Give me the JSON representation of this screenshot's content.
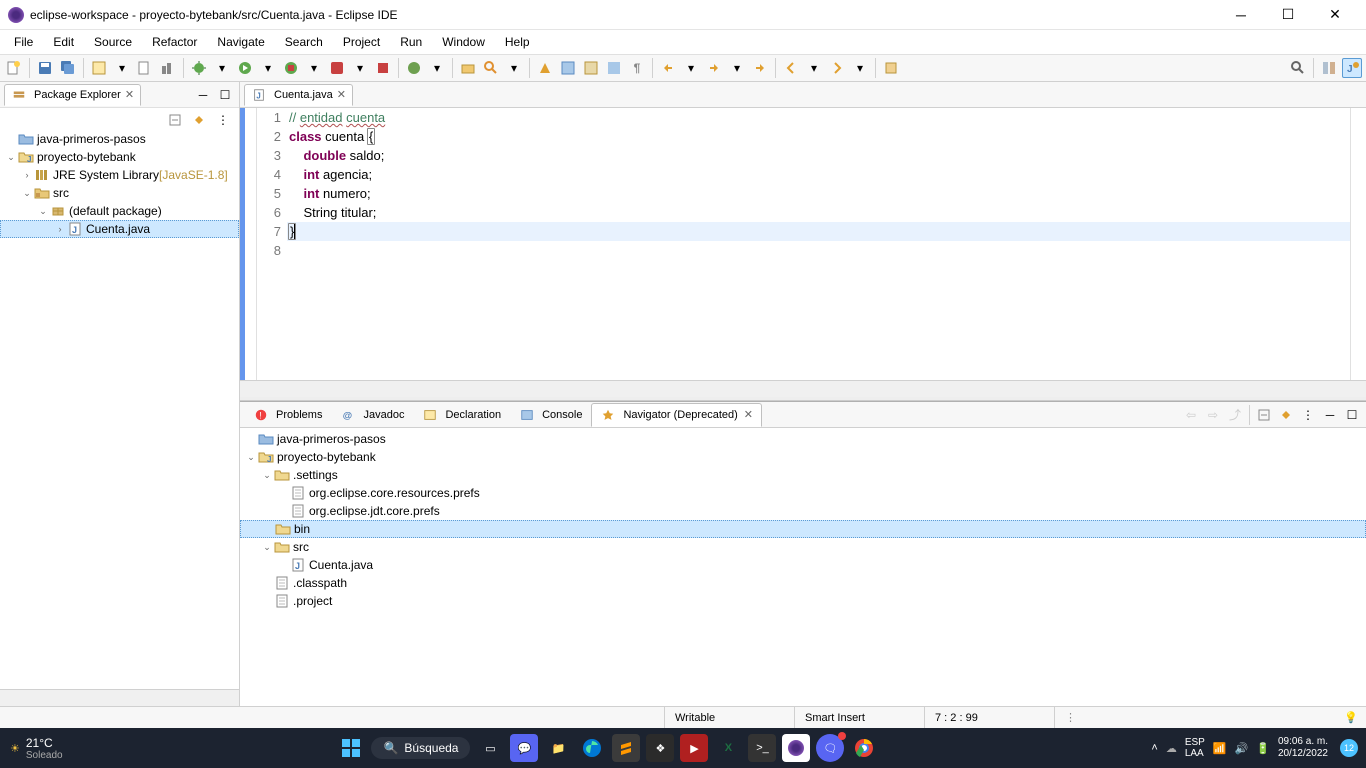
{
  "window": {
    "title": "eclipse-workspace - proyecto-bytebank/src/Cuenta.java - Eclipse IDE"
  },
  "menu": [
    "File",
    "Edit",
    "Source",
    "Refactor",
    "Navigate",
    "Search",
    "Project",
    "Run",
    "Window",
    "Help"
  ],
  "package_explorer": {
    "title": "Package Explorer",
    "items": [
      {
        "indent": 0,
        "twisty": "",
        "icon": "folder",
        "label": "java-primeros-pasos"
      },
      {
        "indent": 0,
        "twisty": "v",
        "icon": "jproj",
        "label": "proyecto-bytebank"
      },
      {
        "indent": 1,
        "twisty": ">",
        "icon": "lib",
        "label": "JRE System Library",
        "suffix": "[JavaSE-1.8]"
      },
      {
        "indent": 1,
        "twisty": "v",
        "icon": "srcfolder",
        "label": "src"
      },
      {
        "indent": 2,
        "twisty": "v",
        "icon": "pkg",
        "label": "(default package)"
      },
      {
        "indent": 3,
        "twisty": ">",
        "icon": "jfile",
        "label": "Cuenta.java",
        "selected": true
      }
    ]
  },
  "editor": {
    "tab": "Cuenta.java",
    "lines": [
      {
        "n": 1,
        "html": [
          {
            "t": "// ",
            "c": "cmt"
          },
          {
            "t": "entidad",
            "c": "cmt underline-squiggle"
          },
          {
            "t": " ",
            "c": "cmt"
          },
          {
            "t": "cuenta",
            "c": "cmt underline-squiggle"
          }
        ]
      },
      {
        "n": 2,
        "html": [
          {
            "t": "class",
            "c": "kw1"
          },
          {
            "t": " cuenta "
          },
          {
            "t": "{",
            "c": "brmatch"
          }
        ]
      },
      {
        "n": 3,
        "html": [
          {
            "t": "    "
          },
          {
            "t": "double",
            "c": "kw1"
          },
          {
            "t": " saldo;"
          }
        ]
      },
      {
        "n": 4,
        "html": [
          {
            "t": "    "
          },
          {
            "t": "int",
            "c": "kw1"
          },
          {
            "t": " agencia;"
          }
        ]
      },
      {
        "n": 5,
        "html": [
          {
            "t": "    "
          },
          {
            "t": "int",
            "c": "kw1"
          },
          {
            "t": " numero;"
          }
        ]
      },
      {
        "n": 6,
        "html": [
          {
            "t": "    String titular;"
          }
        ]
      },
      {
        "n": 7,
        "hl": true,
        "html": [
          {
            "t": "}",
            "c": "brmatch"
          },
          {
            "t": "",
            "caret": true
          }
        ]
      },
      {
        "n": 8,
        "html": [
          {
            "t": ""
          }
        ]
      }
    ]
  },
  "bottom_tabs": [
    {
      "label": "Problems",
      "icon": "problems"
    },
    {
      "label": "Javadoc",
      "icon": "javadoc"
    },
    {
      "label": "Declaration",
      "icon": "decl"
    },
    {
      "label": "Console",
      "icon": "console"
    },
    {
      "label": "Navigator (Deprecated)",
      "icon": "nav",
      "active": true,
      "close": true
    }
  ],
  "navigator": [
    {
      "indent": 0,
      "twisty": "",
      "icon": "folder",
      "label": "java-primeros-pasos"
    },
    {
      "indent": 0,
      "twisty": "v",
      "icon": "jproj",
      "label": "proyecto-bytebank"
    },
    {
      "indent": 1,
      "twisty": "v",
      "icon": "ofolder",
      "label": ".settings"
    },
    {
      "indent": 2,
      "twisty": "",
      "icon": "file",
      "label": "org.eclipse.core.resources.prefs"
    },
    {
      "indent": 2,
      "twisty": "",
      "icon": "file",
      "label": "org.eclipse.jdt.core.prefs"
    },
    {
      "indent": 1,
      "twisty": "",
      "icon": "ofolder",
      "label": "bin",
      "selected": true
    },
    {
      "indent": 1,
      "twisty": "v",
      "icon": "ofolder",
      "label": "src"
    },
    {
      "indent": 2,
      "twisty": "",
      "icon": "jfile",
      "label": "Cuenta.java"
    },
    {
      "indent": 1,
      "twisty": "",
      "icon": "file",
      "label": ".classpath"
    },
    {
      "indent": 1,
      "twisty": "",
      "icon": "file",
      "label": ".project"
    }
  ],
  "status": {
    "writable": "Writable",
    "insert": "Smart Insert",
    "pos": "7 : 2 : 99"
  },
  "taskbar": {
    "temp": "21°C",
    "weather": "Soleado",
    "search": "Búsqueda",
    "lang1": "ESP",
    "lang2": "LAA",
    "time": "09:06 a. m.",
    "date": "20/12/2022"
  }
}
